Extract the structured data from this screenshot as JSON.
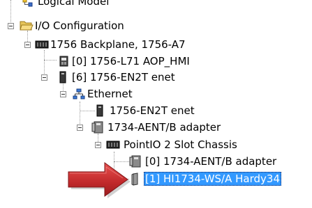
{
  "tree": {
    "logical_model_label": "Logical Model",
    "io_config_label": "I/O Configuration",
    "backplane_label": "1756 Backplane, 1756-A7",
    "l71_label": "[0] 1756-L71 AOP_HMI",
    "en2t_label": "[6] 1756-EN2T enet",
    "ethernet_label": "Ethernet",
    "en2t_port_label": "1756-EN2T enet",
    "aent_label": "1734-AENT/B adapter",
    "chassis_label": "PointIO 2 Slot Chassis",
    "aent_slot_label": "[0] 1734-AENT/B adapter",
    "hardy_label": "[1] HI1734-WS/A Hardy34"
  },
  "colors": {
    "selection": "#3399ff",
    "arrow": "#c0282a"
  }
}
